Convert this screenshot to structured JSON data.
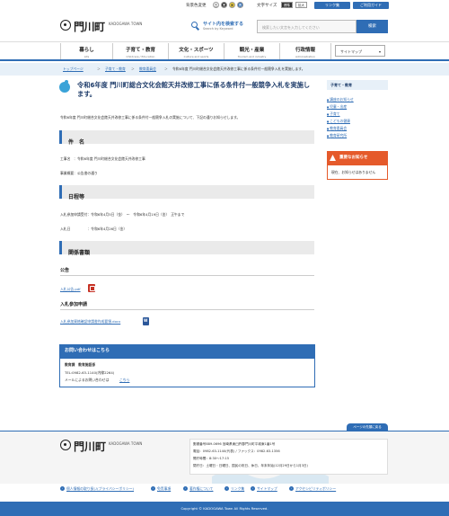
{
  "topbar": {
    "bg_color_label": "背景色変更",
    "bg_options": [
      "白",
      "黒",
      "黄",
      "青"
    ],
    "font_size_label": "文字サイズ",
    "font_options": [
      "標準",
      "拡大"
    ],
    "link_mail": "リンク集",
    "link_guide": "ご利用ガイド"
  },
  "header": {
    "logo_text": "門川町",
    "logo_en": "KADOGAWA TOWN",
    "search_label": "サイト内を検索する",
    "search_sub": "Search by Keyword",
    "search_placeholder": "検索したい文言を入力してください",
    "search_button": "検索"
  },
  "nav": {
    "items": [
      {
        "jp": "暮らし",
        "en": "Life"
      },
      {
        "jp": "子育て・教育",
        "en": "Childcare / Education"
      },
      {
        "jp": "文化・スポーツ",
        "en": "Culture and sports"
      },
      {
        "jp": "観光・産業",
        "en": "Tourism and industry"
      },
      {
        "jp": "行政情報",
        "en": "Administration"
      }
    ],
    "sitemap": "サイトマップ"
  },
  "breadcrumb": {
    "items": [
      "トップページ",
      "子育て・教育",
      "教育委員会"
    ],
    "current": "令和6年度 門川町総合文化会館天井改修工事に係る条件付一般競争入札を実施します。"
  },
  "page": {
    "title": "令和6年度 門川町総合文化会館天井改修工事に係る条件付一般競争入札を実施します。",
    "intro": "令和6年度 門川町総合文化会館天井改修工事に係る条件付一般競争入札の実施について、下記の通りお知らせします。",
    "sec1": {
      "heading": "件　名",
      "line1": "工事名　：令和6年度 門川町総合文化会館天井改修工事",
      "line2": "事業概要：公告書の通り"
    },
    "sec2": {
      "heading": "日程等",
      "line1": "入札参加申請受付：令和6年4月5日（金）　～　令和6年4月19日（金）　正午まで",
      "line2": "入札日　　　　　：令和6年4月26日（金）"
    },
    "sec3": {
      "heading": "関係書類",
      "sub1": "公告",
      "file1": "入札公告.pdf",
      "sub2": "入札参加申請",
      "file2": "入札参加資格確認申請書作成要領.docx"
    },
    "contact": {
      "heading": "お問い合わせはこちら",
      "dept": "教育課　教育施設係",
      "tel": "TEL:0982-63-1140(内線2264)",
      "mail_prefix": "メールによるお問い合わせは",
      "mail_link": "こちら"
    }
  },
  "sidebar": {
    "heading": "子育て・教育",
    "items": [
      "講座のお知らせ",
      "児童・出産",
      "子育て",
      "こどもの健康",
      "教育委員会",
      "教育研究所"
    ],
    "warning_heading": "重要なお知らせ",
    "warning_text": "現在、お知らせはありません"
  },
  "footer": {
    "page_top": "ページの先頭に戻る",
    "logo_text": "門川町",
    "logo_en": "KADOGAWA TOWN",
    "info": [
      "郵便番号889-0696 宮崎県東臼杵郡門川町平城東1番1号",
      "電話：0982-63-1140(代表) / ファックス：0982-63-1356",
      "開庁時間：8:30～17:15",
      "閉庁日：土曜日・日曜日、国民の祝日、休日、年末年始(12月29日から1月3日)"
    ],
    "links": [
      "個人情報の取り扱い(プライバシーポリシー)",
      "免責事項",
      "著作権について",
      "リンク集",
      "サイトマップ",
      "アクセシビリティポリシー"
    ],
    "copyright": "Copyright © KADOGAWA Town All Rights Reserved."
  },
  "colors": {
    "accent": "#2f6db5",
    "breadcrumb_bg": "#e7f0f8",
    "warning": "#e55a2b",
    "title": "#1e3c6a"
  }
}
